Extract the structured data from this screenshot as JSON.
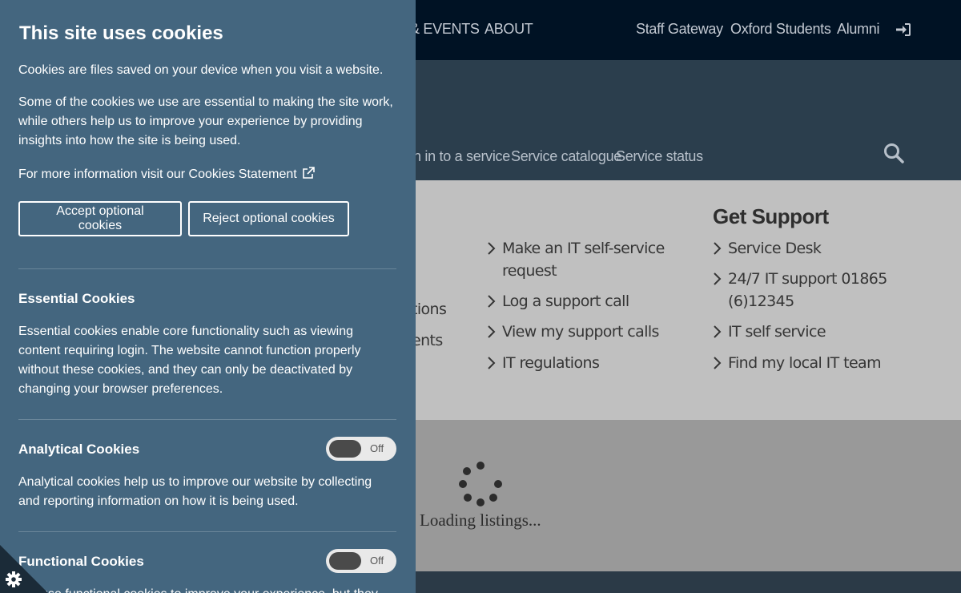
{
  "topnav": {
    "items": [
      "& EVENTS",
      "ABOUT",
      "Staff Gateway",
      "Oxford Students",
      "Alumni"
    ],
    "signin_icon": "sign-in-icon"
  },
  "subnav": {
    "items": [
      "n in to a service",
      "Service catalogue",
      "Service status"
    ],
    "search_icon": "search-icon"
  },
  "links": {
    "left_partials": [
      "tions",
      "ents"
    ],
    "middle": [
      "Make an IT self-service request",
      "Log a support call",
      "View my support calls",
      "IT regulations"
    ],
    "support_heading": "Get Support",
    "support": [
      "Service Desk",
      "24/7 IT support 01865 (6)12345",
      "IT self service",
      "Find my local IT team"
    ]
  },
  "listings": {
    "loading_text": "Loading listings..."
  },
  "cookie": {
    "title": "This site uses cookies",
    "intro": "Cookies are files saved on your device when you visit a website.",
    "essential_note": "Some of the cookies we use are essential to making the site work, while others help us to improve your experience by providing insights into how the site is being used.",
    "more_info_prefix": "For more information visit our ",
    "statement_link": "Cookies Statement",
    "accept_label": "Accept optional cookies",
    "reject_label": "Reject optional cookies",
    "sections": [
      {
        "title": "Essential Cookies",
        "text": "Essential cookies enable core functionality such as viewing content requiring login. The website cannot function properly without these cookies, and they can only be deactivated by changing your browser preferences."
      },
      {
        "title": "Analytical Cookies",
        "text": "Analytical cookies help us to improve our website by collecting and reporting information on how it is being used.",
        "toggle": "Off"
      },
      {
        "title": "Functional Cookies",
        "text": "We use functional cookies to improve your experience, but they",
        "toggle": "Off"
      }
    ],
    "settings_icon": "gear-icon"
  },
  "colors": {
    "panel_bg": "#44667f",
    "topbar_bg": "#001224",
    "subbar_bg": "#2b3e4d"
  }
}
